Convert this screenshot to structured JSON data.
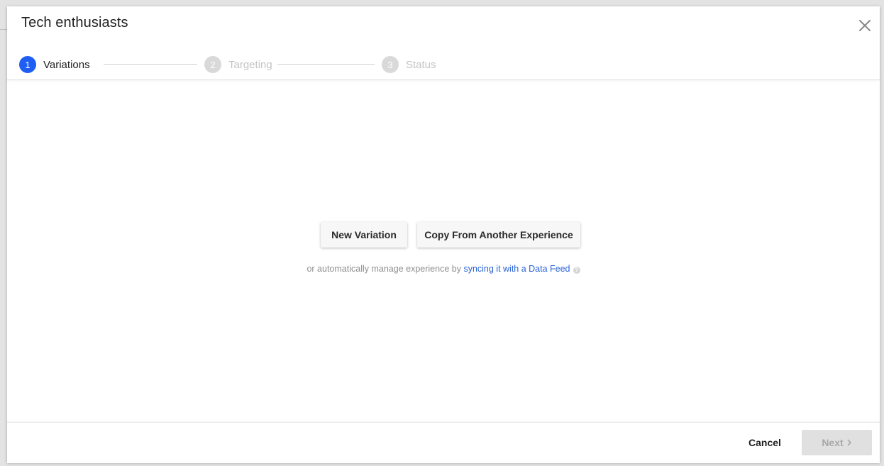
{
  "modal": {
    "title": "Tech enthusiasts",
    "close_icon": "close-icon"
  },
  "stepper": {
    "steps": [
      {
        "number": "1",
        "label": "Variations",
        "state": "active"
      },
      {
        "number": "2",
        "label": "Targeting",
        "state": "inactive"
      },
      {
        "number": "3",
        "label": "Status",
        "state": "inactive"
      }
    ]
  },
  "body": {
    "new_variation_label": "New Variation",
    "copy_label": "Copy From Another Experience",
    "hint_prefix": "or automatically manage experience by",
    "hint_link": "syncing it with a Data Feed",
    "help_icon_glyph": "?"
  },
  "footer": {
    "cancel_label": "Cancel",
    "next_label": "Next",
    "next_icon": "chevron-right-icon"
  },
  "colors": {
    "accent": "#1e5ef3",
    "link": "#2a63d6",
    "inactive_step": "#d9d9d9"
  }
}
